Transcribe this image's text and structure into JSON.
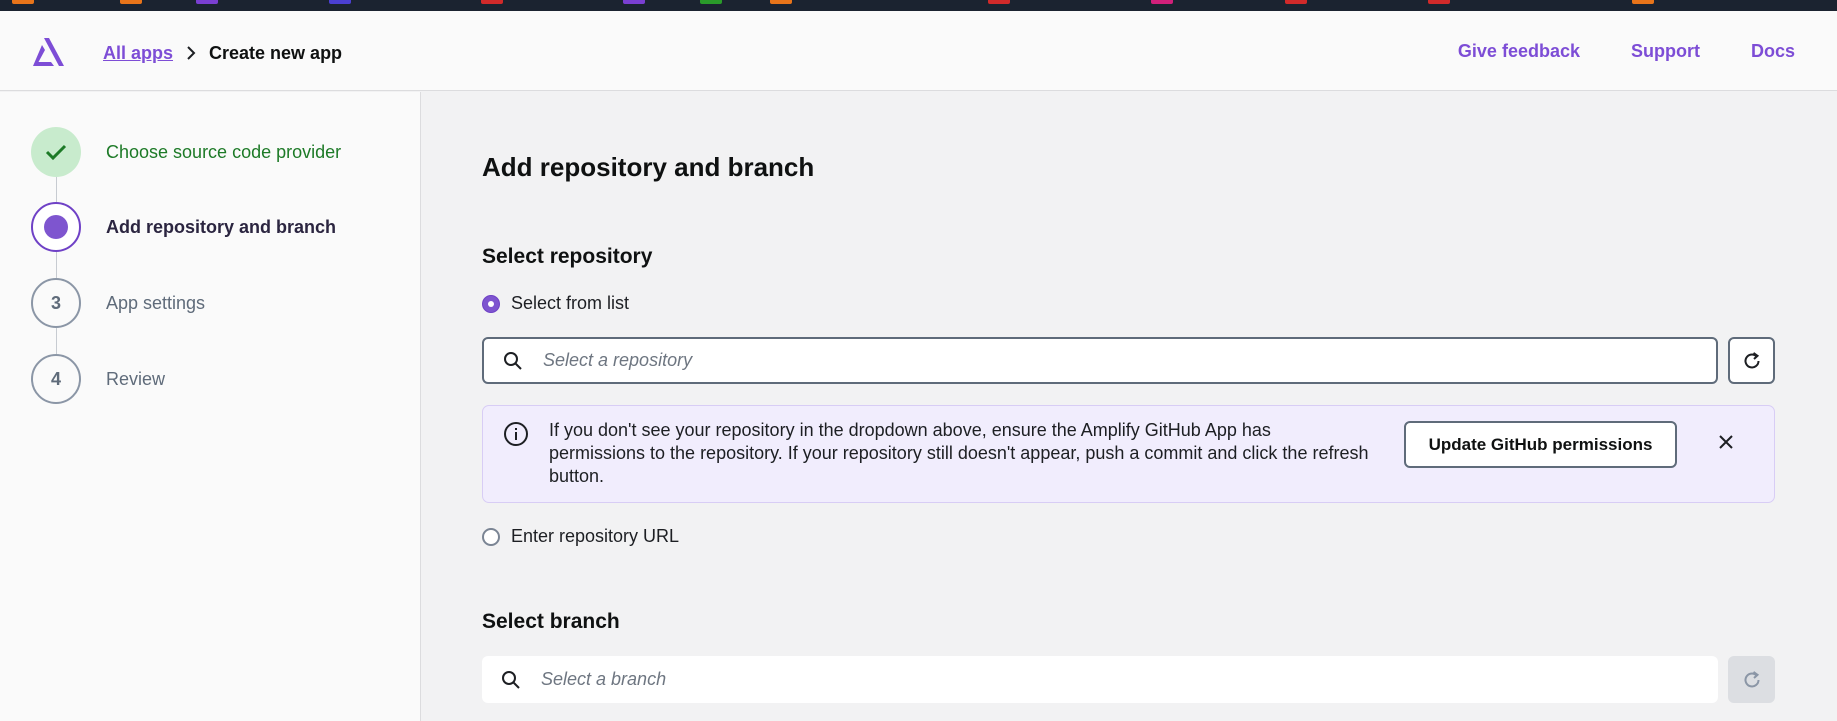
{
  "header": {
    "breadcrumb": {
      "root": "All apps",
      "current": "Create new app"
    },
    "links": [
      "Give feedback",
      "Support",
      "Docs"
    ]
  },
  "steps": [
    {
      "label": "Choose source code provider",
      "status": "complete"
    },
    {
      "label": "Add repository and branch",
      "status": "current"
    },
    {
      "number": "3",
      "label": "App settings",
      "status": "upcoming"
    },
    {
      "number": "4",
      "label": "Review",
      "status": "upcoming"
    }
  ],
  "main": {
    "title": "Add repository and branch",
    "repository": {
      "section_title": "Select repository",
      "option_list": "Select from list",
      "option_url": "Enter repository URL",
      "selected_option": "Select from list",
      "search_placeholder": "Select a repository",
      "search_value": ""
    },
    "alert": {
      "text": "If you don't see your repository in the dropdown above, ensure the Amplify GitHub App has permissions to the repository. If your repository still doesn't appear, push a commit and click the refresh button.",
      "button_label": "Update GitHub permissions"
    },
    "branch": {
      "section_title": "Select branch",
      "search_placeholder": "Select a branch",
      "search_value": ""
    }
  },
  "colors": {
    "accent": "#7d4dd6",
    "success": "#1d7a27",
    "success_bg": "#c8ebcd",
    "info_bg": "#f1edfd",
    "topbar": "#1b2330"
  }
}
